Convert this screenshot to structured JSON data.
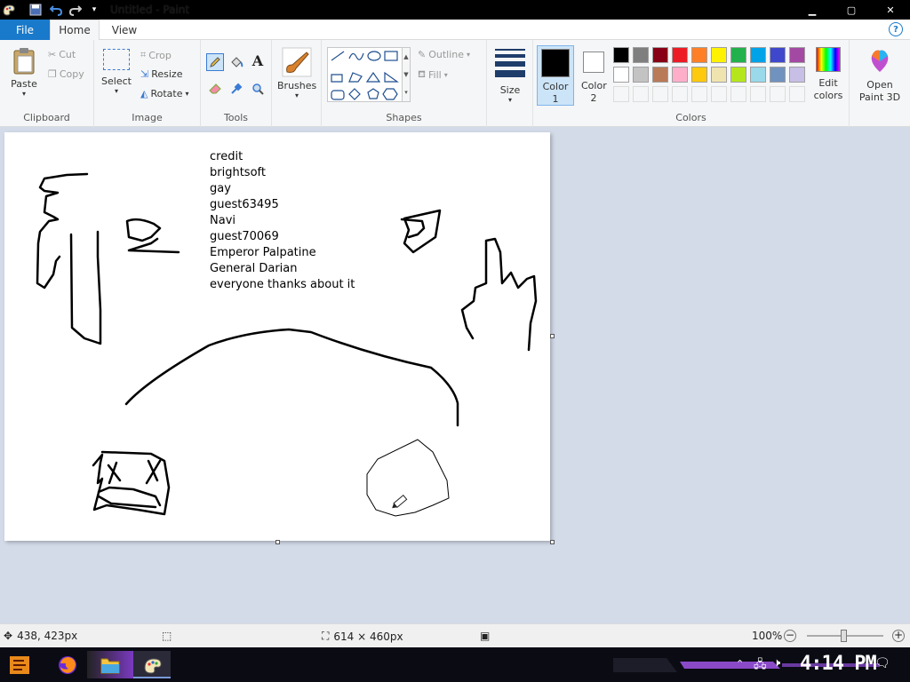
{
  "titlebar": {
    "title": "Untitled - Paint",
    "minimize": "▁",
    "maximize": "▢",
    "close": "✕"
  },
  "menu": {
    "file": "File",
    "home": "Home",
    "view": "View",
    "help": "?"
  },
  "clipboard": {
    "paste": "Paste",
    "cut": "Cut",
    "copy": "Copy",
    "label": "Clipboard"
  },
  "image": {
    "select": "Select",
    "crop": "Crop",
    "resize": "Resize",
    "rotate": "Rotate",
    "label": "Image"
  },
  "tools": {
    "label": "Tools"
  },
  "brushes": {
    "label": "Brushes"
  },
  "shapes": {
    "outline": "Outline",
    "fill": "Fill",
    "label": "Shapes"
  },
  "size": {
    "label": "Size"
  },
  "colors": {
    "color1": "Color 1",
    "color2": "Color 2",
    "color1_value": "#000000",
    "color2_value": "#ffffff",
    "edit": "Edit colors",
    "label": "Colors",
    "row1": [
      "#000000",
      "#7f7f7f",
      "#880015",
      "#ed1c24",
      "#ff7f27",
      "#fff200",
      "#22b14c",
      "#00a2e8",
      "#3f48cc",
      "#a349a4"
    ],
    "row2": [
      "#ffffff",
      "#c3c3c3",
      "#b97a57",
      "#ffaec9",
      "#ffc90e",
      "#efe4b0",
      "#b5e61d",
      "#99d9ea",
      "#7092be",
      "#c8bfe7"
    ]
  },
  "paint3d": {
    "label": "Open Paint 3D"
  },
  "canvas_text": [
    "credit",
    "brightsoft",
    "gay",
    "guest63495",
    "Navi",
    "guest70069",
    "Emperor Palpatine",
    "General Darian",
    "everyone thanks about it"
  ],
  "status": {
    "cursor": "438, 423px",
    "size": "614 × 460px",
    "zoom": "100%"
  },
  "taskbar": {
    "clock": "4:14 PM"
  }
}
